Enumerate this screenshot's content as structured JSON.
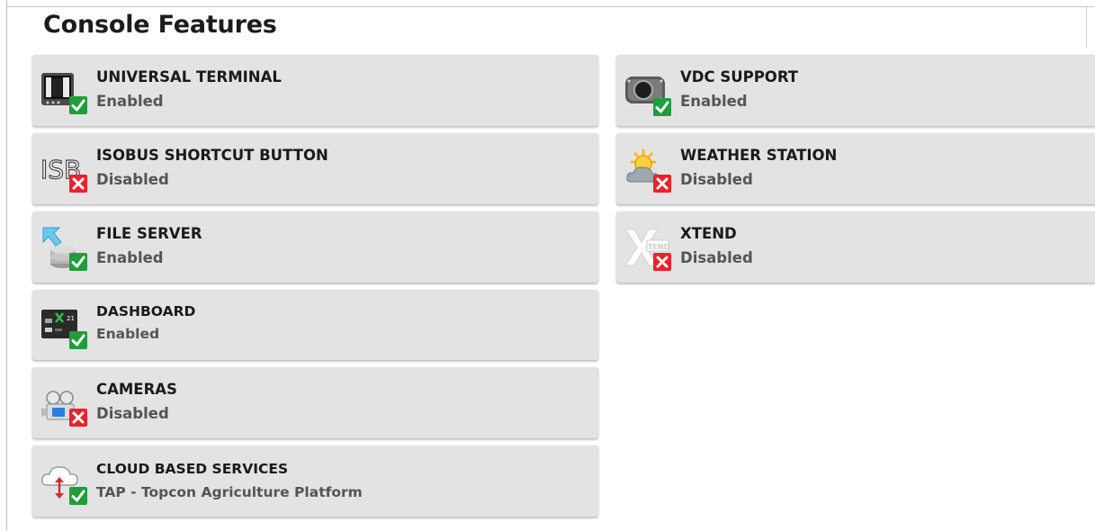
{
  "page": {
    "title": "Console Features"
  },
  "features": {
    "left": [
      {
        "name": "UNIVERSAL TERMINAL",
        "status": "Enabled",
        "icon": "universal-terminal-icon",
        "state": "enabled"
      },
      {
        "name": "ISOBUS SHORTCUT BUTTON",
        "status": "Disabled",
        "icon": "isobus-shortcut-icon",
        "state": "disabled",
        "icon_text": "ISB"
      },
      {
        "name": "FILE SERVER",
        "status": "Enabled",
        "icon": "file-server-icon",
        "state": "enabled"
      },
      {
        "name": "DASHBOARD",
        "status": "Enabled",
        "icon": "dashboard-icon",
        "state": "enabled",
        "icon_text": "21"
      },
      {
        "name": "CAMERAS",
        "status": "Disabled",
        "icon": "cameras-icon",
        "state": "disabled"
      },
      {
        "name": "CLOUD BASED SERVICES",
        "status": "TAP - Topcon Agriculture Platform",
        "icon": "cloud-services-icon",
        "state": "enabled"
      }
    ],
    "right": [
      {
        "name": "VDC SUPPORT",
        "status": "Enabled",
        "icon": "vdc-support-icon",
        "state": "enabled"
      },
      {
        "name": "WEATHER STATION",
        "status": "Disabled",
        "icon": "weather-station-icon",
        "state": "disabled"
      },
      {
        "name": "XTEND",
        "status": "Disabled",
        "icon": "xtend-icon",
        "state": "disabled",
        "icon_text": "TEND"
      }
    ]
  },
  "colors": {
    "enabled_badge": "#1f9e3a",
    "disabled_badge": "#e8232b",
    "tile_bg": "#e3e3e3"
  }
}
